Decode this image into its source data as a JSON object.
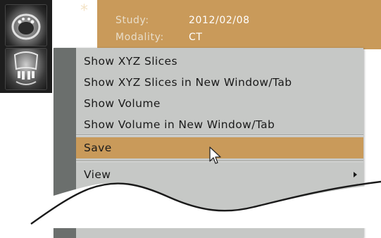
{
  "study": {
    "star": "*",
    "rows": [
      {
        "key": "Study:",
        "value": "2012/02/08"
      },
      {
        "key": "Modality:",
        "value": "CT"
      }
    ]
  },
  "thumbnails": [
    "axial-ct-thumbnail",
    "coronal-ct-thumbnail"
  ],
  "context_menu": {
    "items": [
      {
        "label": "Show XYZ Slices"
      },
      {
        "label": "Show XYZ Slices in New Window/Tab"
      },
      {
        "label": "Show Volume"
      },
      {
        "label": "Show Volume in New Window/Tab"
      },
      {
        "label": "Save",
        "highlighted": true
      },
      {
        "label": "View",
        "submenu": true
      }
    ]
  },
  "colors": {
    "accent": "#c99a5a",
    "menu_bg": "#c6c8c6",
    "gutter": "#6b6f6d",
    "thumb_bg": "#1d1d1d"
  },
  "icons": [
    "star-icon",
    "submenu-arrow-icon",
    "mouse-pointer-icon"
  ]
}
